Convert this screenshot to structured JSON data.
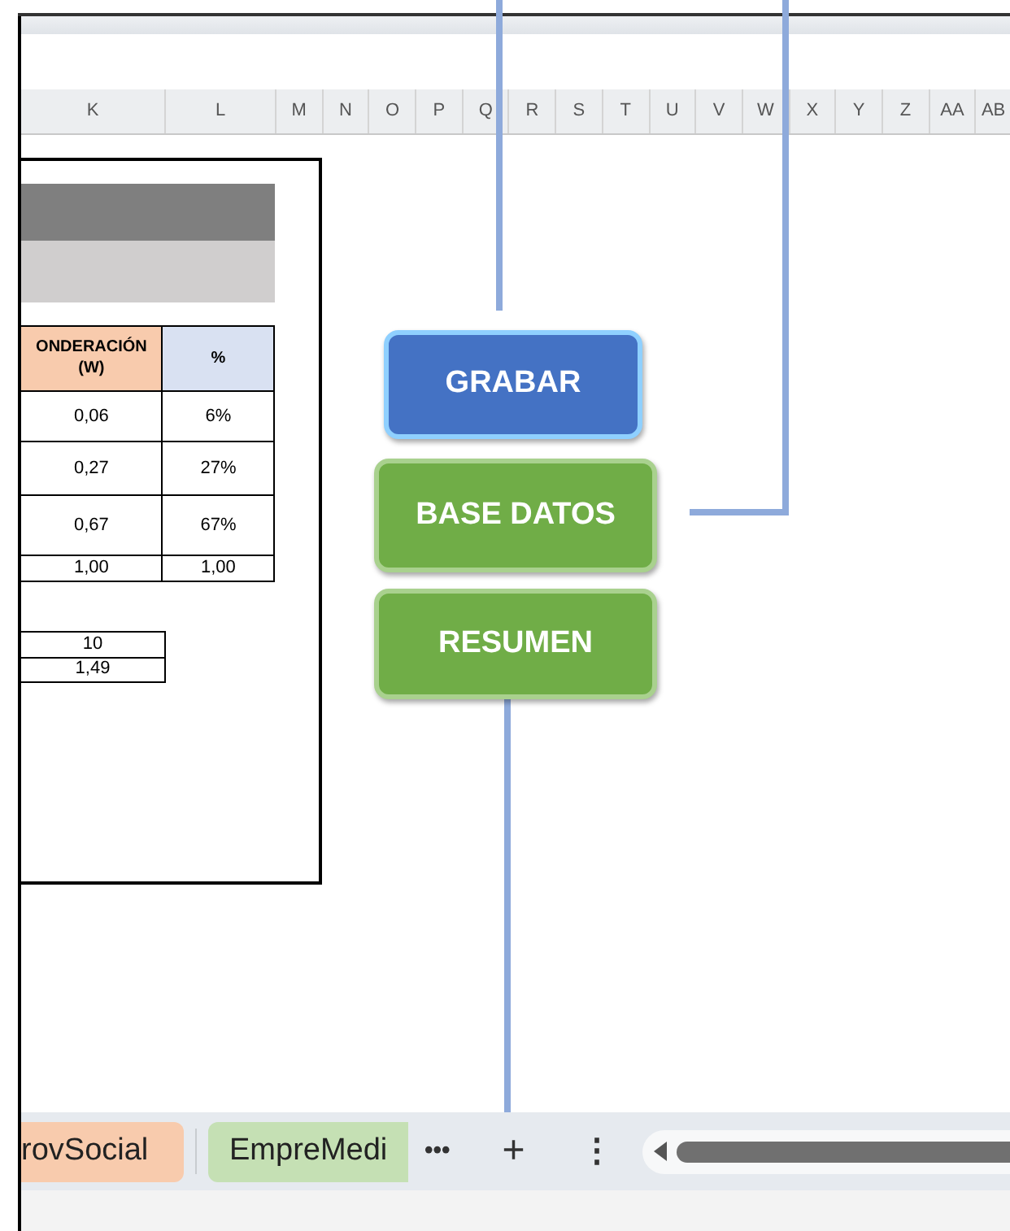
{
  "column_headers": [
    "K",
    "L",
    "M",
    "N",
    "O",
    "P",
    "Q",
    "R",
    "S",
    "T",
    "U",
    "V",
    "W",
    "X",
    "Y",
    "Z",
    "AA",
    "AB"
  ],
  "weights_table": {
    "columns": [
      "ONDERACIÓN\n(W)",
      "%"
    ],
    "rows": [
      [
        "0,06",
        "6%"
      ],
      [
        "0,27",
        "27%"
      ],
      [
        "0,67",
        "67%"
      ]
    ],
    "total": [
      "1,00",
      "1,00"
    ]
  },
  "small_table": [
    "10",
    "1,49"
  ],
  "buttons": [
    {
      "label": "GRABAR",
      "color": "#4472c4"
    },
    {
      "label": "BASE DATOS",
      "color": "#70ad47"
    },
    {
      "label": "RESUMEN",
      "color": "#70ad47"
    }
  ],
  "sheet_tabs": [
    {
      "label": "rovSocial",
      "color": "#f8cbad"
    },
    {
      "label": "EmpreMedi",
      "color": "#c5e0b4"
    }
  ],
  "tab_bar": {
    "more": "•••",
    "add": "+",
    "menu": "⋮"
  }
}
